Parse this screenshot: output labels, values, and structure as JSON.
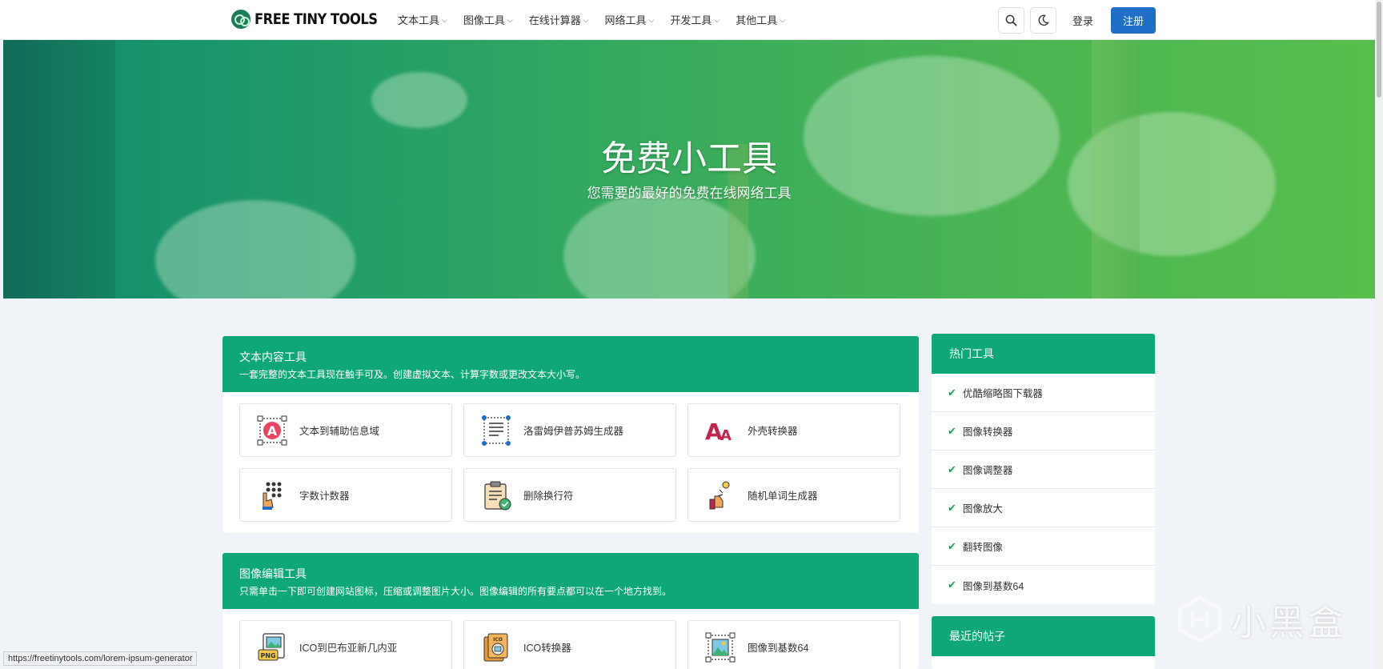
{
  "header": {
    "brand": "FREE TINY TOOLS",
    "nav": [
      {
        "label": "文本工具"
      },
      {
        "label": "图像工具"
      },
      {
        "label": "在线计算器"
      },
      {
        "label": "网络工具"
      },
      {
        "label": "开发工具"
      },
      {
        "label": "其他工具"
      }
    ],
    "login": "登录",
    "register": "注册"
  },
  "hero": {
    "title": "免费小工具",
    "subtitle": "您需要的最好的免费在线网络工具"
  },
  "sections": [
    {
      "title": "文本内容工具",
      "desc": "一套完整的文本工具现在触手可及。创建虚拟文本、计算字数或更改文本大小写。",
      "tools": [
        {
          "label": "文本到辅助信息域",
          "icon": "text-a-icon"
        },
        {
          "label": "洛雷姆伊普苏姆生成器",
          "icon": "lorem-doc-icon"
        },
        {
          "label": "外壳转换器",
          "icon": "case-aa-icon"
        },
        {
          "label": "字数计数器",
          "icon": "hand-count-icon"
        },
        {
          "label": "删除换行符",
          "icon": "clipboard-check-icon"
        },
        {
          "label": "随机单词生成器",
          "icon": "random-hand-icon"
        }
      ]
    },
    {
      "title": "图像编辑工具",
      "desc": "只需单击一下即可创建网站图标，压缩或调整图片大小。图像编辑的所有要点都可以在一个地方找到。",
      "tools": [
        {
          "label": "ICO到巴布亚新几内亚",
          "icon": "png-file-icon"
        },
        {
          "label": "ICO转换器",
          "icon": "ico-file-icon"
        },
        {
          "label": "图像到基数64",
          "icon": "image-frame-icon"
        }
      ]
    }
  ],
  "sidebar": {
    "popular_title": "热门工具",
    "popular": [
      {
        "label": "优酷缩略图下载器"
      },
      {
        "label": "图像转换器"
      },
      {
        "label": "图像调整器"
      },
      {
        "label": "图像放大"
      },
      {
        "label": "翻转图像"
      },
      {
        "label": "图像到基数64"
      }
    ],
    "recent_title": "最近的帖子"
  },
  "statusbar": "https://freetinytools.com/lorem-ipsum-generator",
  "watermark": "小黑盒",
  "colors": {
    "accent": "#10a778",
    "primary_button": "#1f6fc9",
    "check": "#1f9d55"
  }
}
